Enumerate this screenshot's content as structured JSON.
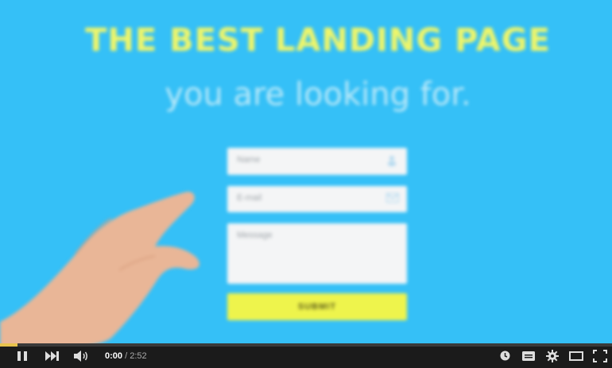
{
  "video": {
    "headline": "THE BEST LANDING PAGE",
    "subheadline": "you are looking for.",
    "form": {
      "name_placeholder": "Name",
      "email_placeholder": "E-mail",
      "message_placeholder": "Message",
      "submit_label": "SUBMIT"
    },
    "colors": {
      "background": "#35c0f7",
      "headline": "#eef56a",
      "submit": "#eef44c"
    }
  },
  "player": {
    "progress_fraction": 0.028,
    "current_time": "0:00",
    "separator": " / ",
    "duration": "2:52",
    "icons": [
      "pause-icon",
      "next-icon",
      "volume-icon",
      "watch-later-icon",
      "captions-icon",
      "settings-icon",
      "theater-icon",
      "fullscreen-icon"
    ]
  }
}
